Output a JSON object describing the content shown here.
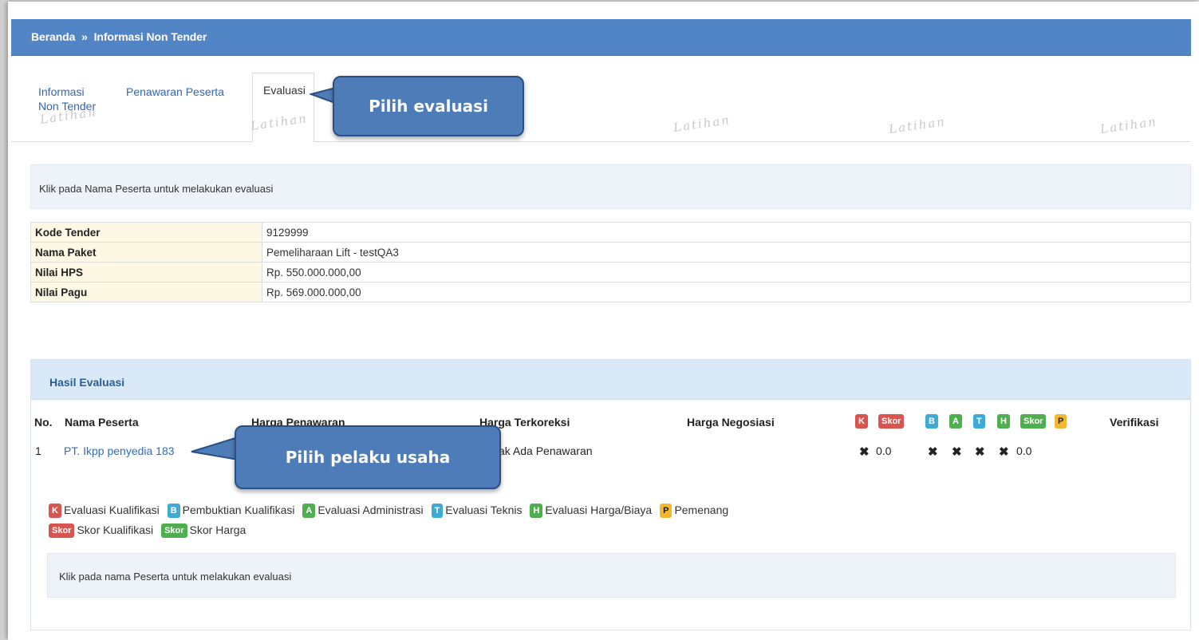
{
  "breadcrumb": {
    "home": "Beranda",
    "separator": "»",
    "current": "Informasi Non Tender"
  },
  "tabs": [
    {
      "label_line1": "Informasi",
      "label_line2": "Non Tender"
    },
    {
      "label": "Penawaran Peserta"
    },
    {
      "label": "Evaluasi",
      "active": true
    }
  ],
  "watermark": "Latihan",
  "callouts": {
    "tab": "Pilih evaluasi",
    "participant": "Pilih pelaku usaha"
  },
  "info_message": "Klik pada Nama Peserta untuk melakukan evaluasi",
  "details": [
    {
      "key": "Kode Tender",
      "value": "9129999"
    },
    {
      "key": "Nama Paket",
      "value": "Pemeliharaan Lift - testQA3"
    },
    {
      "key": "Nilai HPS",
      "value": "Rp. 550.000.000,00"
    },
    {
      "key": "Nilai Pagu",
      "value": "Rp. 569.000.000,00"
    }
  ],
  "results": {
    "title": "Hasil Evaluasi",
    "headers": {
      "no": "No.",
      "name": "Nama Peserta",
      "offer": "Harga Penawaran",
      "corrected": "Harga Terkoreksi",
      "negotiated": "Harga Negosiasi",
      "verification": "Verifikasi"
    },
    "header_badges": [
      "K",
      "Skor",
      "B",
      "A",
      "T",
      "H",
      "Skor",
      "P"
    ],
    "row": {
      "no": "1",
      "name": "PT. Ikpp penyedia 183",
      "corrected": "ak Ada Penawaran",
      "k": "✖",
      "skor1": "0.0",
      "b": "✖",
      "a": "✖",
      "t": "✖",
      "h": "✖",
      "skor2": "0.0"
    },
    "legend": [
      {
        "badge": "K",
        "label": "Evaluasi Kualifikasi"
      },
      {
        "badge": "B",
        "label": "Pembuktian Kualifikasi"
      },
      {
        "badge": "A",
        "label": "Evaluasi Administrasi"
      },
      {
        "badge": "T",
        "label": "Evaluasi Teknis"
      },
      {
        "badge": "H",
        "label": "Evaluasi Harga/Biaya"
      },
      {
        "badge": "P",
        "label": "Pemenang"
      },
      {
        "badge": "Skor",
        "label": "Skor Kualifikasi"
      },
      {
        "badge": "Skor",
        "label": "Skor Harga"
      }
    ],
    "note": "Klik pada nama Peserta untuk melakukan evaluasi"
  },
  "colors": {
    "header": "#5185c6",
    "callout": "#4e7cb8",
    "red": "#d9534f",
    "blue": "#3faad6",
    "green": "#4fae4e",
    "yellow": "#f4b731"
  }
}
